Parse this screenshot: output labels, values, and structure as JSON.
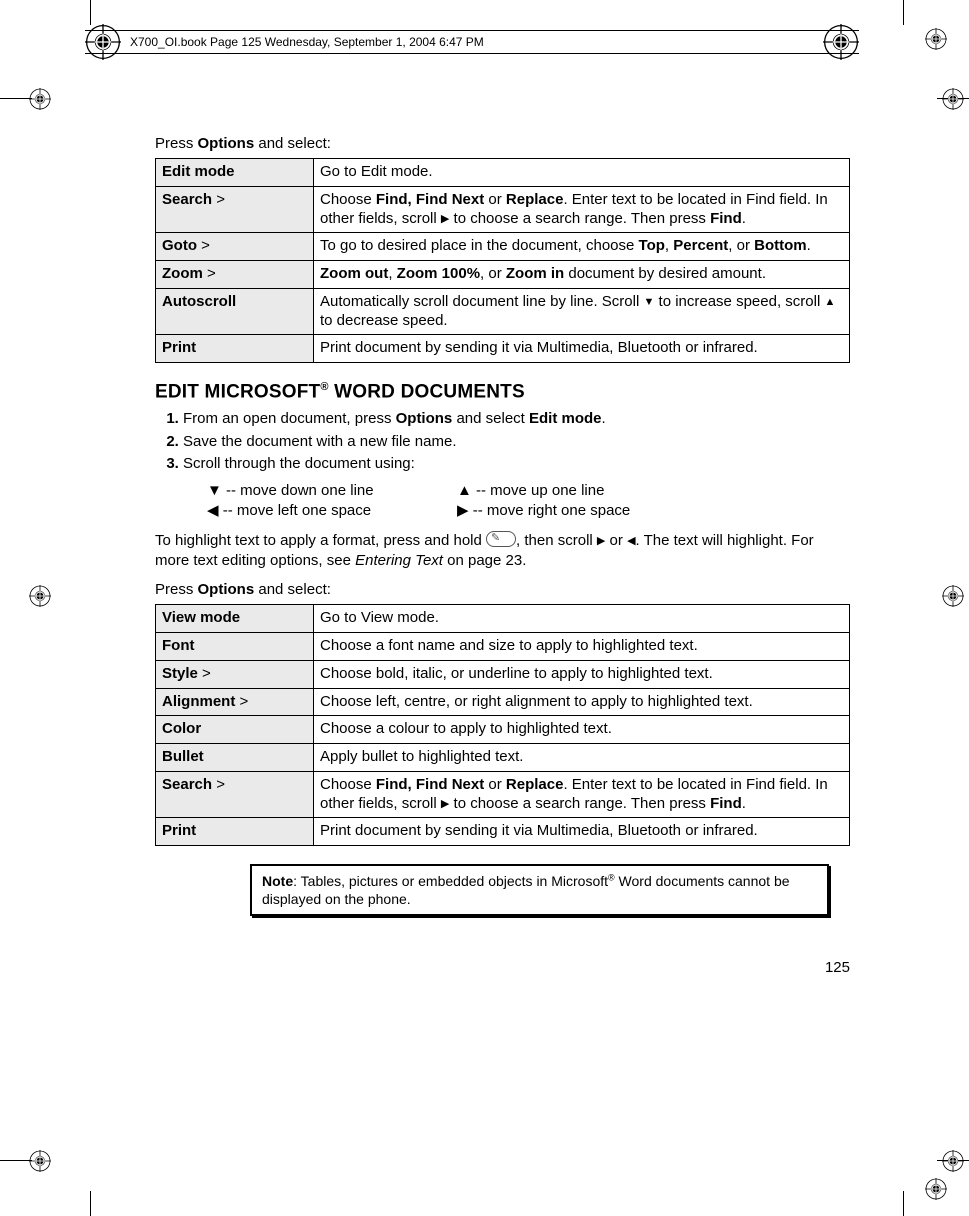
{
  "header_text": "X700_OI.book  Page 125  Wednesday, September 1, 2004  6:47 PM",
  "intro1_pre": "Press ",
  "intro1_b": "Options",
  "intro1_post": " and select:",
  "t1": [
    {
      "k": "Edit mode",
      "gt": "",
      "v_parts": [
        {
          "t": "Go to Edit mode."
        }
      ]
    },
    {
      "k": "Search",
      "gt": " >",
      "v_parts": [
        {
          "t": "Choose "
        },
        {
          "b": "Find, Find Next"
        },
        {
          "t": " or "
        },
        {
          "b": "Replace"
        },
        {
          "t": ". Enter text to be located in Find field. In other fields, scroll "
        },
        {
          "a": "▶"
        },
        {
          "t": " to choose a search range. Then press "
        },
        {
          "b": "Find"
        },
        {
          "t": "."
        }
      ]
    },
    {
      "k": "Goto",
      "gt": " >",
      "v_parts": [
        {
          "t": "To go to desired place in the document, choose "
        },
        {
          "b": "Top"
        },
        {
          "t": ", "
        },
        {
          "b": "Percent"
        },
        {
          "t": ", or "
        },
        {
          "b": "Bottom"
        },
        {
          "t": "."
        }
      ]
    },
    {
      "k": "Zoom",
      "gt": " >",
      "v_parts": [
        {
          "b": "Zoom out"
        },
        {
          "t": ", "
        },
        {
          "b": "Zoom 100%"
        },
        {
          "t": ", or "
        },
        {
          "b": "Zoom in"
        },
        {
          "t": " document by desired amount."
        }
      ]
    },
    {
      "k": "Autoscroll",
      "gt": "",
      "v_parts": [
        {
          "t": "Automatically scroll document line by line. Scroll "
        },
        {
          "a": "▼"
        },
        {
          "t": " to increase speed, scroll "
        },
        {
          "a": "▲"
        },
        {
          "t": " to decrease speed."
        }
      ]
    },
    {
      "k": "Print",
      "gt": "",
      "v_parts": [
        {
          "t": "Print document by sending it via Multimedia, Bluetooth or infrared."
        }
      ]
    }
  ],
  "section_heading": "EDIT MICROSOFT® WORD DOCUMENTS",
  "steps": [
    {
      "parts": [
        {
          "t": "From an open document, press "
        },
        {
          "b": "Options"
        },
        {
          "t": " and select "
        },
        {
          "b": "Edit mode"
        },
        {
          "t": "."
        }
      ]
    },
    {
      "parts": [
        {
          "t": "Save the document with a new file name."
        }
      ]
    },
    {
      "parts": [
        {
          "t": "Scroll through the document using:"
        }
      ]
    }
  ],
  "moves": {
    "a": "▼ -- move down one line",
    "b": "▲ -- move up one line",
    "c": "◀ -- move left one space",
    "d": "▶ -- move right one space"
  },
  "para1": {
    "pre": "To highlight text to apply a format, press and hold ",
    "mid": ", then scroll ",
    "or": " or ",
    "post1": ". The text will highlight. For more text editing options, see ",
    "ital": "Entering Text",
    "post2": " on page 23."
  },
  "intro2_pre": "Press ",
  "intro2_b": "Options",
  "intro2_post": " and select:",
  "t2": [
    {
      "k": "View mode",
      "gt": "",
      "v_parts": [
        {
          "t": "Go to View mode."
        }
      ]
    },
    {
      "k": "Font",
      "gt": "",
      "v_parts": [
        {
          "t": "Choose a font name and size to apply to highlighted text."
        }
      ]
    },
    {
      "k": "Style",
      "gt": " >",
      "v_parts": [
        {
          "t": "Choose bold, italic, or underline to apply to highlighted text."
        }
      ]
    },
    {
      "k": "Alignment",
      "gt": " >",
      "v_parts": [
        {
          "t": "Choose left, centre, or right alignment to apply to highlighted text."
        }
      ]
    },
    {
      "k": "Color",
      "gt": "",
      "v_parts": [
        {
          "t": "Choose a colour to apply to highlighted text."
        }
      ]
    },
    {
      "k": "Bullet",
      "gt": "",
      "v_parts": [
        {
          "t": "Apply bullet to highlighted text."
        }
      ]
    },
    {
      "k": "Search",
      "gt": " >",
      "v_parts": [
        {
          "t": "Choose "
        },
        {
          "b": "Find, Find Next"
        },
        {
          "t": " or "
        },
        {
          "b": "Replace"
        },
        {
          "t": ". Enter text to be located in Find field. In other fields, scroll "
        },
        {
          "a": "▶"
        },
        {
          "t": " to choose a search range. Then press "
        },
        {
          "b": "Find"
        },
        {
          "t": "."
        }
      ]
    },
    {
      "k": "Print",
      "gt": "",
      "v_parts": [
        {
          "t": "Print document by sending it via Multimedia, Bluetooth or infrared."
        }
      ]
    }
  ],
  "note": {
    "label": "Note",
    "text_pre": ":  Tables, pictures or embedded objects in Microsoft",
    "sup": "®",
    "text_post": " Word documents cannot be displayed on the phone."
  },
  "page_number": "125"
}
